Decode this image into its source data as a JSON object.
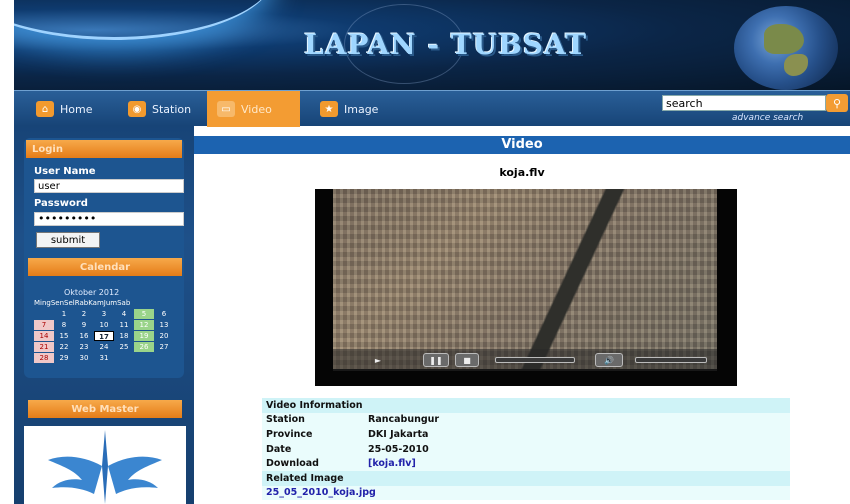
{
  "header": {
    "title": "LAPAN - TUBSAT"
  },
  "nav": {
    "items": [
      {
        "label": "Home",
        "icon": "home-icon"
      },
      {
        "label": "Station",
        "icon": "station-icon"
      },
      {
        "label": "Video",
        "icon": "video-icon",
        "active": true
      },
      {
        "label": "Image",
        "icon": "star-icon"
      }
    ],
    "search": {
      "value": "search",
      "advanced_label": "advance search"
    }
  },
  "sidebar": {
    "login": {
      "heading": "Login",
      "username_label": "User Name",
      "username_value": "user",
      "password_label": "Password",
      "password_value": "•••••••••",
      "submit_label": "submit"
    },
    "calendar": {
      "heading": "Calendar",
      "month": "Oktober 2012",
      "days": [
        "Sen",
        "Sel",
        "Rab",
        "Kam",
        "Jum",
        "Sab",
        "Min"
      ],
      "days_header": "MingSenSelRabKamJumSab",
      "weeks": [
        [
          "",
          "1",
          "2",
          "3",
          "4",
          "5",
          "6"
        ],
        [
          "7",
          "8",
          "9",
          "10",
          "11",
          "12",
          "13"
        ],
        [
          "14",
          "15",
          "16",
          "17",
          "18",
          "19",
          "20"
        ],
        [
          "21",
          "22",
          "23",
          "24",
          "25",
          "26",
          "27"
        ],
        [
          "28",
          "29",
          "30",
          "31",
          "",
          "",
          ""
        ]
      ],
      "today": "17"
    },
    "webmaster": {
      "heading": "Web Master"
    }
  },
  "main": {
    "heading": "Video",
    "file_name": "koja.flv",
    "player": {
      "play": "►",
      "pause": "❚❚",
      "stop": "■",
      "volume": "🔊"
    },
    "info": {
      "heading": "Video Information",
      "rows": [
        {
          "key": "Station",
          "value": "Rancabungur"
        },
        {
          "key": "Province",
          "value": "DKI Jakarta"
        },
        {
          "key": "Date",
          "value": "25-05-2010"
        },
        {
          "key": "Download",
          "value": "[koja.flv]"
        }
      ],
      "related_heading": "Related Image",
      "related_link": "25_05_2010_koja.jpg"
    }
  },
  "colors": {
    "accent": "#f39c33",
    "nav": "#1c4f87",
    "main_heading": "#1c63b0",
    "info_bg": "#eafcfc"
  }
}
